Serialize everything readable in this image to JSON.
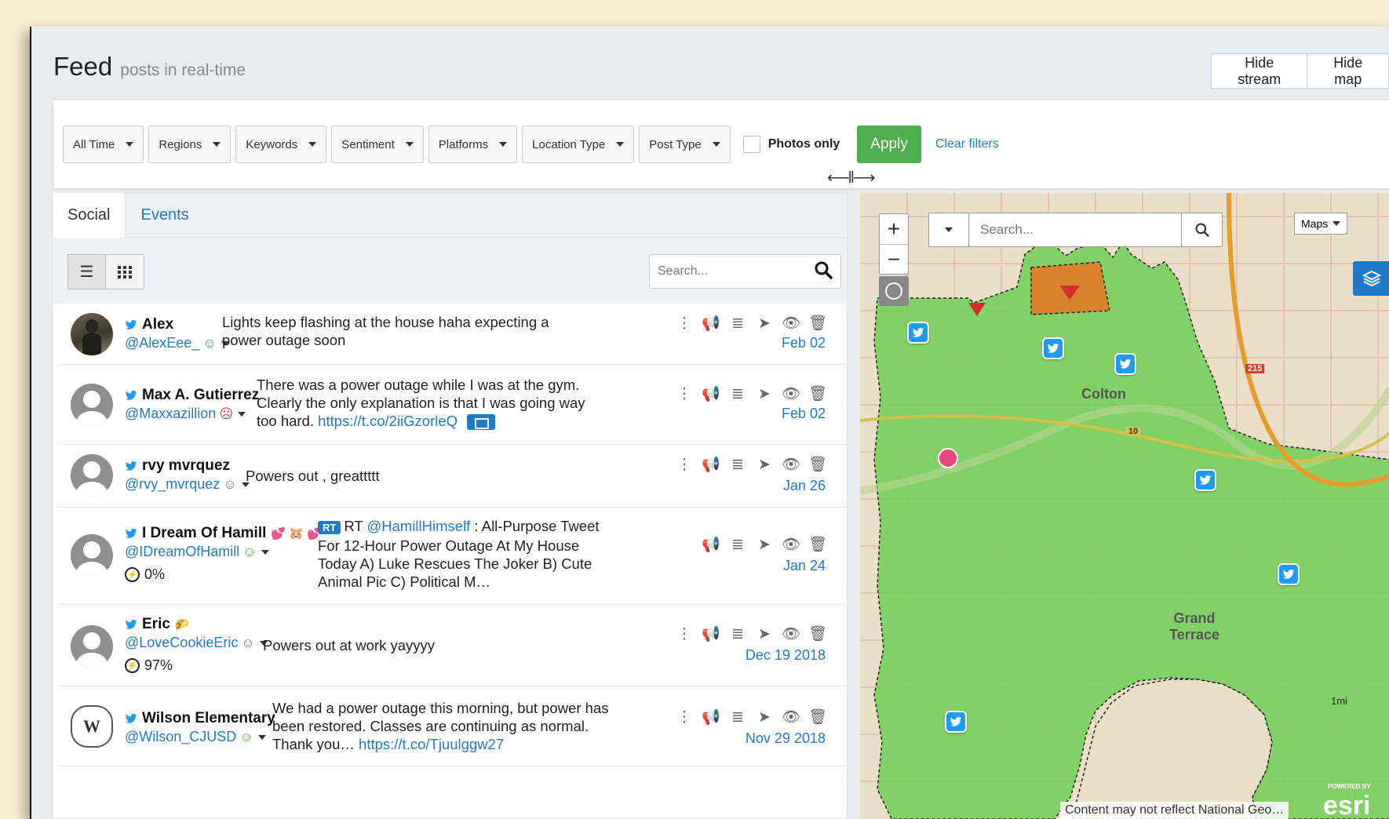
{
  "header": {
    "title": "Feed",
    "subtitle": "posts in real-time"
  },
  "top_buttons": {
    "hide_stream": "Hide stream",
    "hide_map": "Hide map"
  },
  "filters": {
    "items": [
      "All Time",
      "Regions",
      "Keywords",
      "Sentiment",
      "Platforms",
      "Location Type",
      "Post Type"
    ],
    "photos_only": "Photos only",
    "apply": "Apply",
    "clear": "Clear filters"
  },
  "splitter": "⟵‖⟶",
  "tabs": [
    "Social",
    "Events"
  ],
  "feed_search_placeholder": "Search...",
  "posts": [
    {
      "name": "Alex",
      "handle": "@AlexEee_",
      "sentiment": "☺",
      "text": "Lights keep flashing at the house haha expecting a power outage soon",
      "date": "Feb 02"
    },
    {
      "name": "Max A. Gutierrez",
      "handle": "@Maxxazillion",
      "sentiment": "☹",
      "text": "There was a power outage while I was at the gym. Clearly the only explanation is that I was going way too hard.",
      "link": "https://t.co/2iiGzorleQ",
      "date": "Feb 02"
    },
    {
      "name": "rvy mvrquez",
      "handle": "@rvy_mvrquez",
      "sentiment": "☺",
      "text": "Powers out , greattttt",
      "date": "Jan 26"
    },
    {
      "name": "I Dream Of Hamill",
      "emoji": "💕 🐹 💕",
      "handle": "@IDreamOfHamill",
      "sentiment": "☺",
      "percent": "0%",
      "rt_badge": "RT",
      "rt_prefix": "RT",
      "rt_user": "@HamillHimself",
      "text": ": All-Purpose Tweet For 12-Hour Power Outage At My House Today A) Luke Rescues The Joker B) Cute Animal Pic C) Political M…",
      "date": "Jan 24"
    },
    {
      "name": "Eric",
      "emoji": "🌮",
      "handle": "@LoveCookieEric",
      "sentiment": "☺",
      "percent": "97%",
      "text": "Powers out at work yayyyy",
      "date": "Dec 19 2018"
    },
    {
      "name": "Wilson Elementary",
      "handle": "@Wilson_CJUSD",
      "sentiment": "☺",
      "text": "We had a power outage this morning, but power has been restored. Classes are continuing as normal. Thank you…",
      "link": "https://t.co/Tjuulggw27",
      "date": "Nov 29 2018"
    }
  ],
  "map": {
    "search_placeholder": "Search...",
    "maps_button": "Maps",
    "labels": {
      "colton": "Colton",
      "grand_terrace": "Grand Terrace",
      "highway_215": "215",
      "highway_10": "10",
      "scale": "1mi"
    },
    "attribution": "Content may not reflect National Geo…",
    "powered_by": "POWERED BY",
    "esri": "esri"
  },
  "colors": {
    "accent": "#1f7ac9",
    "apply": "#4cae4c",
    "twitter": "#1d9bf0",
    "region": "#6fcf55",
    "alert": "#d9822b"
  }
}
